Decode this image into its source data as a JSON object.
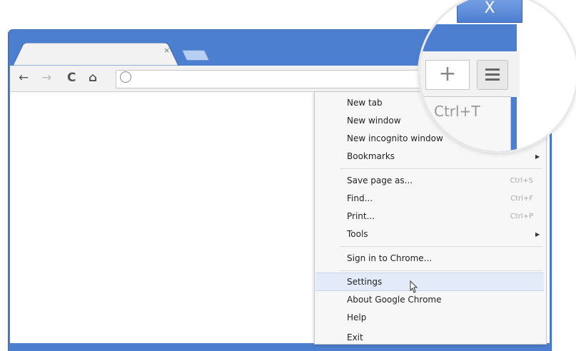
{
  "window": {
    "close_glyph": "X"
  },
  "tab": {
    "close_glyph": "×"
  },
  "toolbar": {
    "back_glyph": "←",
    "forward_glyph": "→",
    "reload_glyph": "C",
    "home_glyph": "⌂"
  },
  "menu": {
    "items": [
      {
        "label": "New tab",
        "shortcut": ""
      },
      {
        "label": "New window",
        "shortcut": ""
      },
      {
        "label": "New incognito window",
        "shortcut": ""
      },
      {
        "label": "Bookmarks",
        "shortcut": "",
        "submenu": true
      },
      {
        "label": "Save page as...",
        "shortcut": "Ctrl+S"
      },
      {
        "label": "Find...",
        "shortcut": "Ctrl+F"
      },
      {
        "label": "Print...",
        "shortcut": "Ctrl+P"
      },
      {
        "label": "Tools",
        "shortcut": "",
        "submenu": true
      },
      {
        "label": "Sign in to Chrome...",
        "shortcut": ""
      },
      {
        "label": "Settings",
        "shortcut": "",
        "highlighted": true
      },
      {
        "label": "About Google Chrome",
        "shortcut": ""
      },
      {
        "label": "Help",
        "shortcut": ""
      },
      {
        "label": "Exit",
        "shortcut": ""
      }
    ],
    "submenu_glyph": "▶"
  },
  "magnifier": {
    "close_glyph": "X",
    "plus_glyph": "+",
    "shortcut": "Ctrl+T"
  },
  "colors": {
    "frame": "#4d7fd0",
    "toolbar": "#f2f2f2",
    "menu_bg": "#f7f7f7",
    "highlight": "#e3ebf8"
  }
}
